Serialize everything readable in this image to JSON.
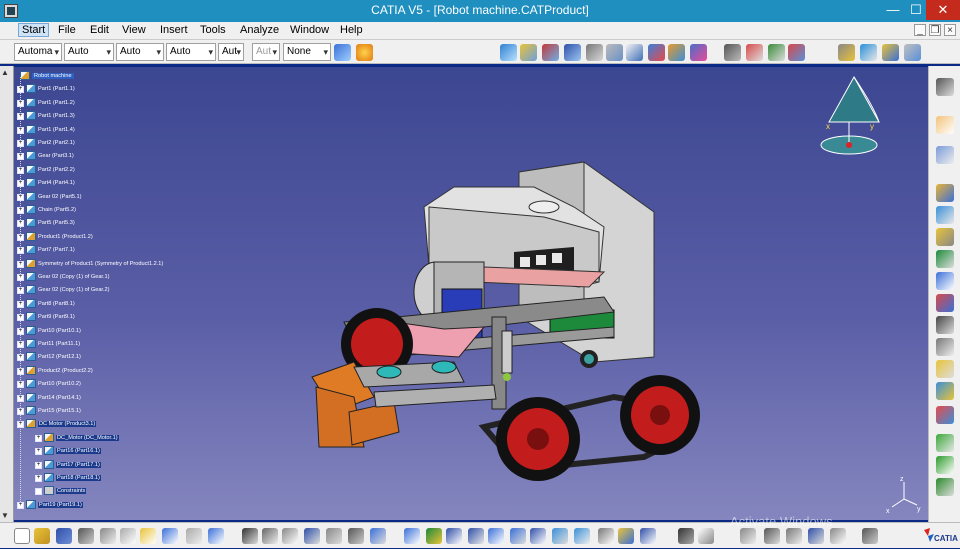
{
  "window": {
    "title": "CATIA V5 - [Robot machine.CATProduct]",
    "minimize": "—",
    "maximize": "☐",
    "close": "✕"
  },
  "menu": {
    "items": [
      "Start",
      "File",
      "Edit",
      "View",
      "Insert",
      "Tools",
      "Analyze",
      "Window",
      "Help"
    ],
    "mdi": {
      "minimize": "_",
      "restore": "❐",
      "close": "×"
    }
  },
  "graphic_properties": {
    "combos": [
      {
        "value": "Automa",
        "disabled": false
      },
      {
        "value": "Auto",
        "disabled": false
      },
      {
        "value": "Auto",
        "disabled": false
      },
      {
        "value": "Auto",
        "disabled": false
      },
      {
        "value": "Aut",
        "disabled": false
      },
      {
        "value": "Aut",
        "disabled": true
      },
      {
        "value": "None",
        "disabled": false
      }
    ]
  },
  "tree": {
    "root": "Robot machine",
    "nodes": [
      {
        "label": "Part1 (Part1.1)",
        "type": "part"
      },
      {
        "label": "Part1 (Part1.2)",
        "type": "part"
      },
      {
        "label": "Part1 (Part1.3)",
        "type": "part"
      },
      {
        "label": "Part1 (Part1.4)",
        "type": "part"
      },
      {
        "label": "Part2 (Part2.1)",
        "type": "part"
      },
      {
        "label": "Gear (Part3.1)",
        "type": "part"
      },
      {
        "label": "Part2 (Part2.2)",
        "type": "part"
      },
      {
        "label": "Part4 (Part4.1)",
        "type": "part"
      },
      {
        "label": "Gear 02 (Part5.1)",
        "type": "part"
      },
      {
        "label": "Chain (Part5.2)",
        "type": "part"
      },
      {
        "label": "Part5 (Part5.3)",
        "type": "part"
      },
      {
        "label": "Product1 (Product1.2)",
        "type": "product"
      },
      {
        "label": "Part7 (Part7.1)",
        "type": "part"
      },
      {
        "label": "Symmetry of Product1 (Symmetry of Product1.2.1)",
        "type": "product"
      },
      {
        "label": "Gear 02 (Copy (1) of Gear.1)",
        "type": "part"
      },
      {
        "label": "Gear 02 (Copy (1) of Gear.2)",
        "type": "part"
      },
      {
        "label": "Part8 (Part8.1)",
        "type": "part"
      },
      {
        "label": "Part9 (Part9.1)",
        "type": "part"
      },
      {
        "label": "Part10 (Part10.1)",
        "type": "part"
      },
      {
        "label": "Part11 (Part11.1)",
        "type": "part"
      },
      {
        "label": "Part12 (Part12.1)",
        "type": "part"
      },
      {
        "label": "Product2 (Product2.2)",
        "type": "product"
      },
      {
        "label": "Part10 (Part10.2)",
        "type": "part"
      },
      {
        "label": "Part14 (Part14.1)",
        "type": "part"
      },
      {
        "label": "Part15 (Part15.1)",
        "type": "part"
      },
      {
        "label": "DC Motor (Product3.1)",
        "type": "product",
        "selected": true
      },
      {
        "label": "DC_Motor (DC_Motor.1)",
        "type": "product",
        "selected": true,
        "indent": 1
      },
      {
        "label": "Part16 (Part16.1)",
        "type": "part",
        "selected": true,
        "indent": 1
      },
      {
        "label": "Part17 (Part17.1)",
        "type": "part",
        "selected": true,
        "indent": 1
      },
      {
        "label": "Part18 (Part18.1)",
        "type": "part",
        "selected": true,
        "indent": 1
      },
      {
        "label": "Constraints",
        "type": "constraints",
        "selected": true,
        "indent": 1
      },
      {
        "label": "Part19 (Part19.1)",
        "type": "part",
        "selected": true
      }
    ]
  },
  "watermark": "Activate Windows",
  "logo": "CATIA"
}
